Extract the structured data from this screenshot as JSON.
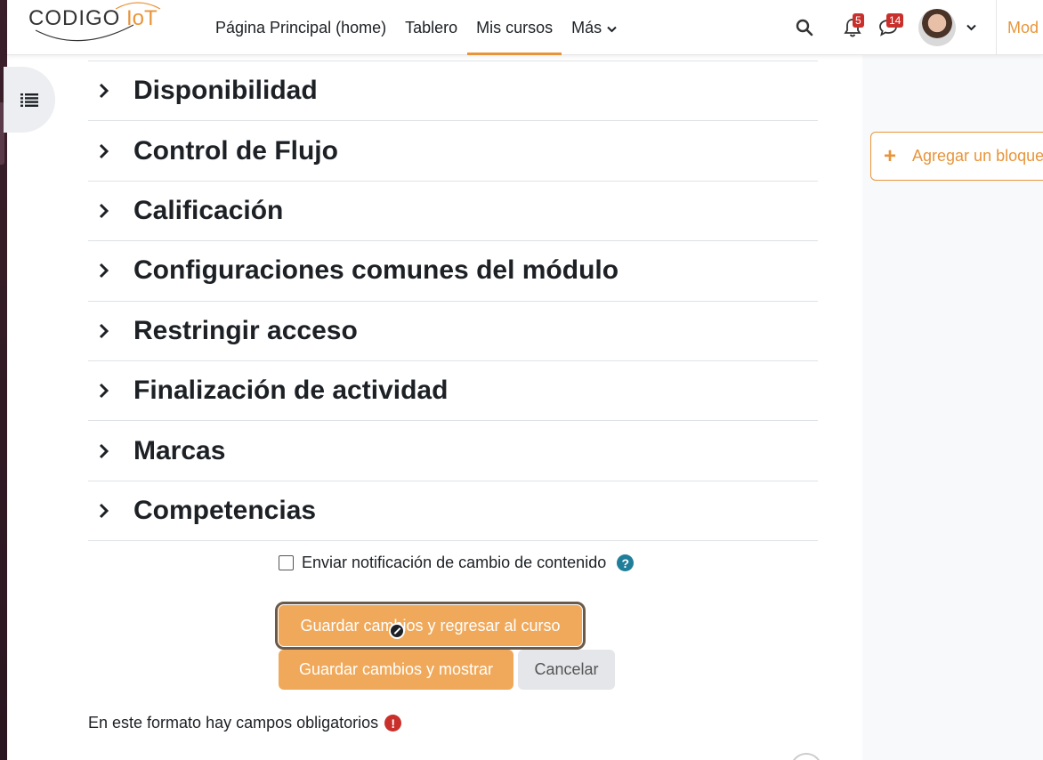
{
  "navbar": {
    "logo_text": "CODIGO IoT",
    "links": [
      {
        "label": "Página Principal (home)",
        "active": false
      },
      {
        "label": "Tablero",
        "active": false
      },
      {
        "label": "Mis cursos",
        "active": true
      },
      {
        "label": "Más",
        "active": false
      }
    ],
    "notifications_count": "5",
    "messages_count": "14",
    "mode_label": "Mod",
    "accent_color": "#e8953a"
  },
  "sections": [
    {
      "title": "Disponibilidad"
    },
    {
      "title": "Control de Flujo"
    },
    {
      "title": "Calificación"
    },
    {
      "title": "Configuraciones comunes del módulo"
    },
    {
      "title": "Restringir acceso"
    },
    {
      "title": "Finalización de actividad"
    },
    {
      "title": "Marcas"
    },
    {
      "title": "Competencias"
    }
  ],
  "form": {
    "notify_label": "Enviar notificación de cambio de contenido",
    "notify_checked": false,
    "help_icon": "?",
    "save_return_label": "Guardar cambios y regresar al curso",
    "save_show_label": "Guardar cambios y mostrar",
    "cancel_label": "Cancelar",
    "required_note": "En este formato hay campos obligatorios",
    "required_icon": "!"
  },
  "blocks": {
    "add_block_label": "Agregar un bloque",
    "add_block_icon": "+"
  }
}
